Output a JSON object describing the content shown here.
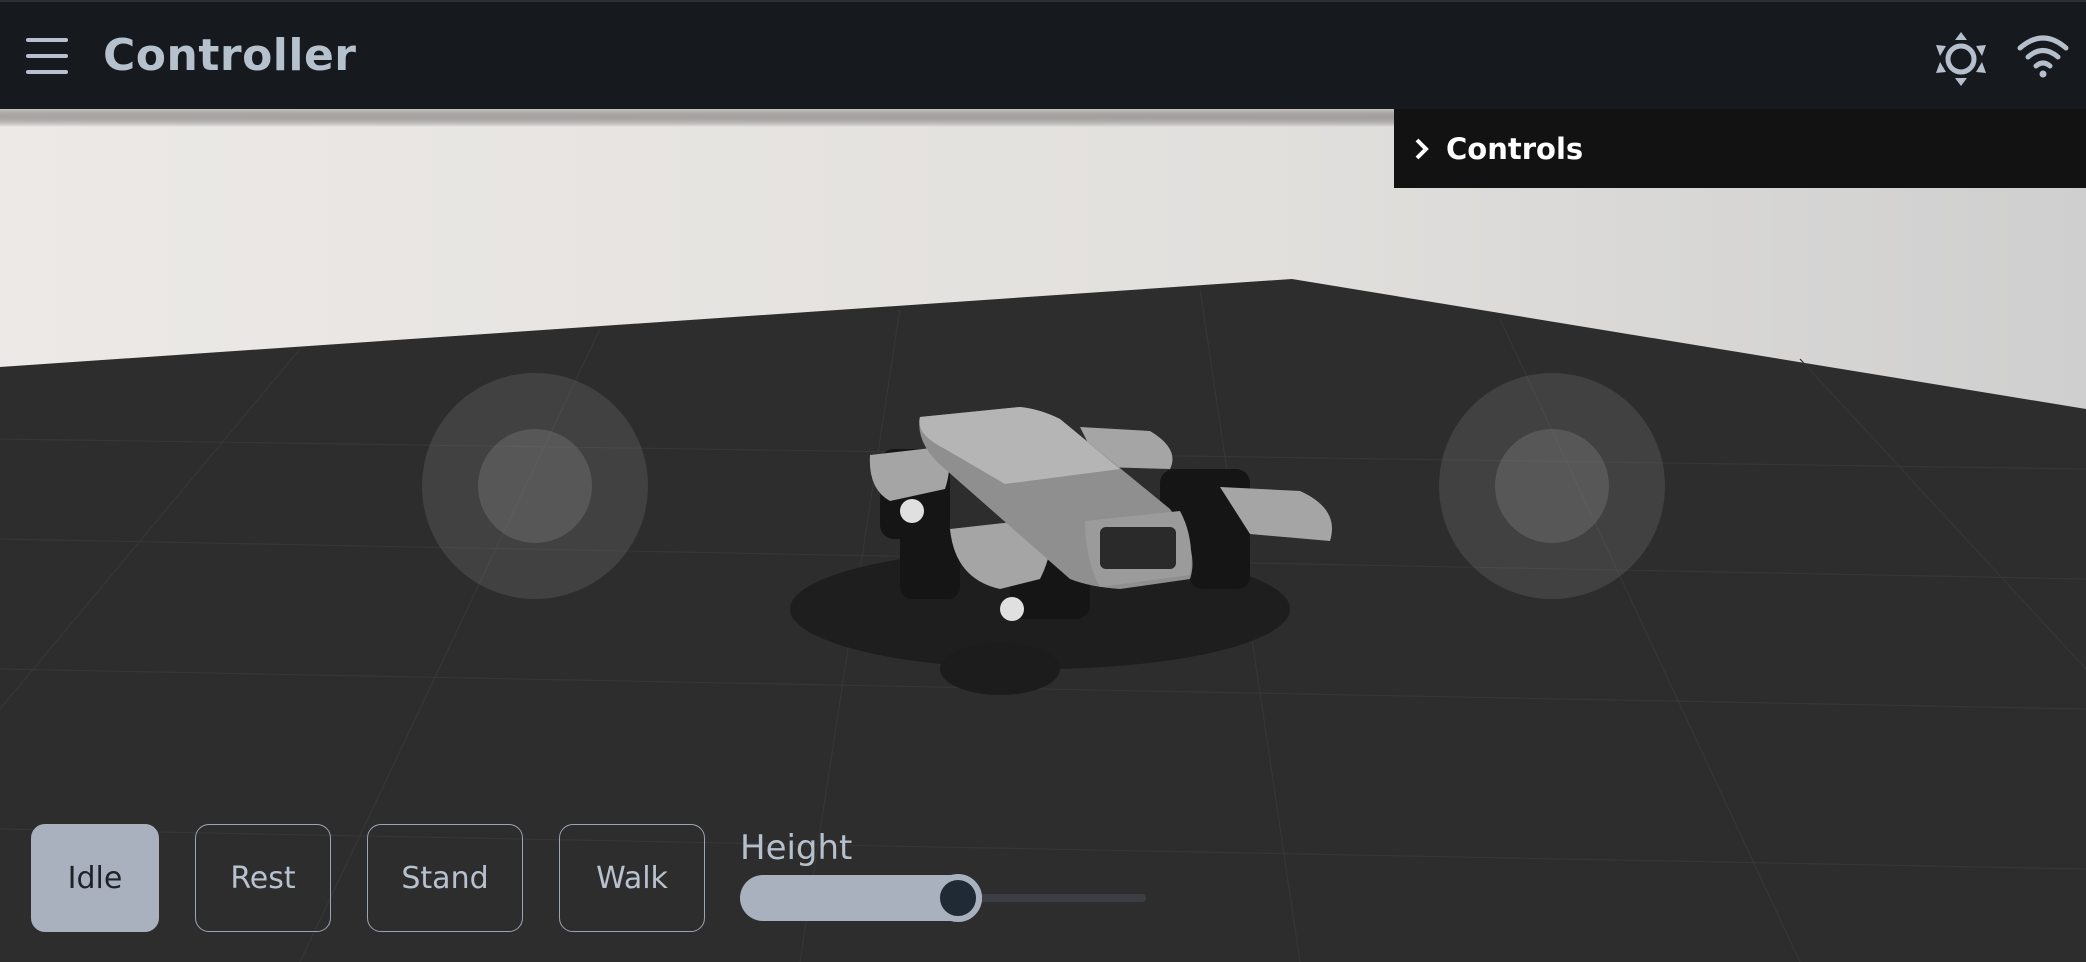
{
  "header": {
    "title": "Controller",
    "menu_icon": "hamburger-menu-icon",
    "brightness_icon": "brightness-icon",
    "wifi_icon": "wifi-icon"
  },
  "controls_panel": {
    "label": "Controls",
    "icon": "chevron-right-icon",
    "expanded": false
  },
  "modes": {
    "buttons": [
      "Idle",
      "Rest",
      "Stand",
      "Walk"
    ],
    "active": "Idle"
  },
  "height_slider": {
    "label": "Height",
    "value_fraction": 0.5
  },
  "colors": {
    "topbar": "#161a1f",
    "accent": "#a9b1be",
    "floor": "#2d2d2d",
    "wall": "#e8e6e3"
  }
}
